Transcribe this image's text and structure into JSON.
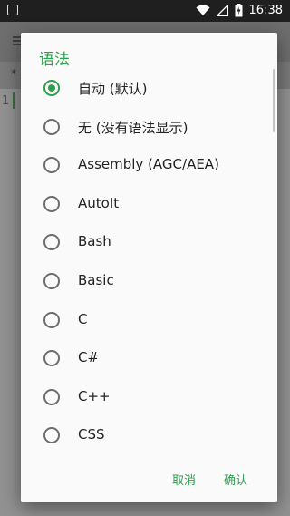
{
  "status": {
    "time": "16:38"
  },
  "dialog": {
    "title": "语法",
    "options": [
      {
        "label": "自动 (默认)",
        "checked": true
      },
      {
        "label": "无 (没有语法显示)",
        "checked": false
      },
      {
        "label": "Assembly (AGC/AEA)",
        "checked": false
      },
      {
        "label": "AutoIt",
        "checked": false
      },
      {
        "label": "Bash",
        "checked": false
      },
      {
        "label": "Basic",
        "checked": false
      },
      {
        "label": "C",
        "checked": false
      },
      {
        "label": "C#",
        "checked": false
      },
      {
        "label": "C++",
        "checked": false
      },
      {
        "label": "CSS",
        "checked": false
      }
    ],
    "cancel_label": "取消",
    "ok_label": "确认"
  },
  "background": {
    "line_number": "1",
    "tab_marker": "*"
  },
  "colors": {
    "accent": "#2e9f4e"
  }
}
